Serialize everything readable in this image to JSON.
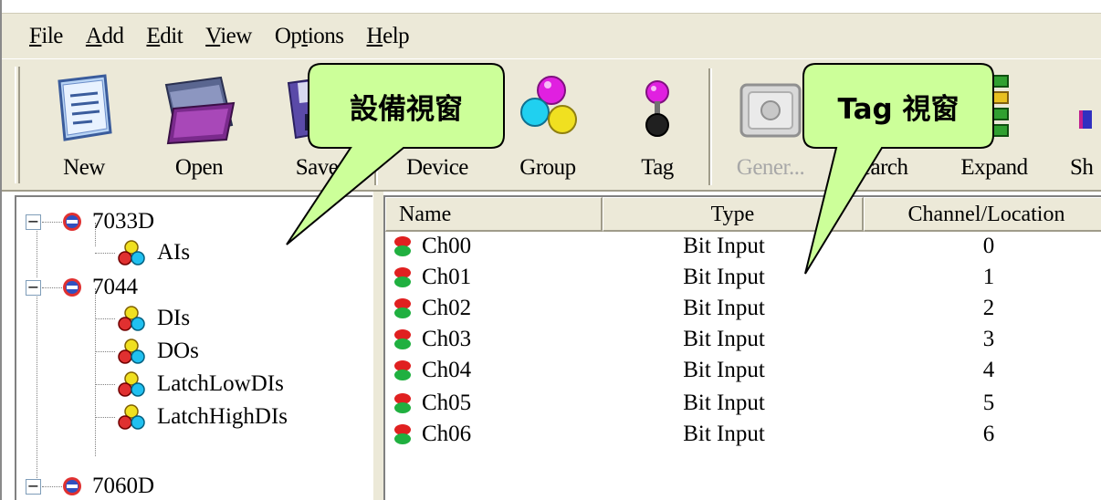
{
  "menu": {
    "file": {
      "pre": "",
      "acc": "F",
      "post": "ile"
    },
    "add": {
      "pre": "",
      "acc": "A",
      "post": "dd"
    },
    "edit": {
      "pre": "",
      "acc": "E",
      "post": "dit"
    },
    "view": {
      "pre": "",
      "acc": "V",
      "post": "iew"
    },
    "options": {
      "pre": "Op",
      "acc": "t",
      "post": "ions"
    },
    "help": {
      "pre": "",
      "acc": "H",
      "post": "elp"
    }
  },
  "toolbar": {
    "new": "New",
    "open": "Open",
    "save": "Save",
    "device": "Device",
    "group": "Group",
    "tag": "Tag",
    "generate": "Gener...",
    "search": "Search",
    "expand": "Expand",
    "show": "Sh"
  },
  "tree": {
    "devices": [
      {
        "label": "7033D",
        "groups": [
          "AIs"
        ]
      },
      {
        "label": "7044",
        "groups": [
          "DIs",
          "DOs",
          "LatchLowDIs",
          "LatchHighDIs"
        ]
      },
      {
        "label": "7060D",
        "groups": []
      }
    ]
  },
  "list": {
    "columns": [
      "Name",
      "Type",
      "Channel/Location"
    ],
    "rows": [
      {
        "name": "Ch00",
        "type": "Bit Input",
        "channel": "0"
      },
      {
        "name": "Ch01",
        "type": "Bit Input",
        "channel": "1"
      },
      {
        "name": "Ch02",
        "type": "Bit Input",
        "channel": "2"
      },
      {
        "name": "Ch03",
        "type": "Bit Input",
        "channel": "3"
      },
      {
        "name": "Ch04",
        "type": "Bit Input",
        "channel": "4"
      },
      {
        "name": "Ch05",
        "type": "Bit Input",
        "channel": "5"
      },
      {
        "name": "Ch06",
        "type": "Bit Input",
        "channel": "6"
      }
    ]
  },
  "callouts": {
    "device_window": "設備視窗",
    "tag_window": "Tag 視窗"
  },
  "colors": {
    "chrome": "#ece9d8",
    "callout_fill": "#ccff99",
    "tag_red": "#e02020",
    "tag_green": "#20b040"
  }
}
